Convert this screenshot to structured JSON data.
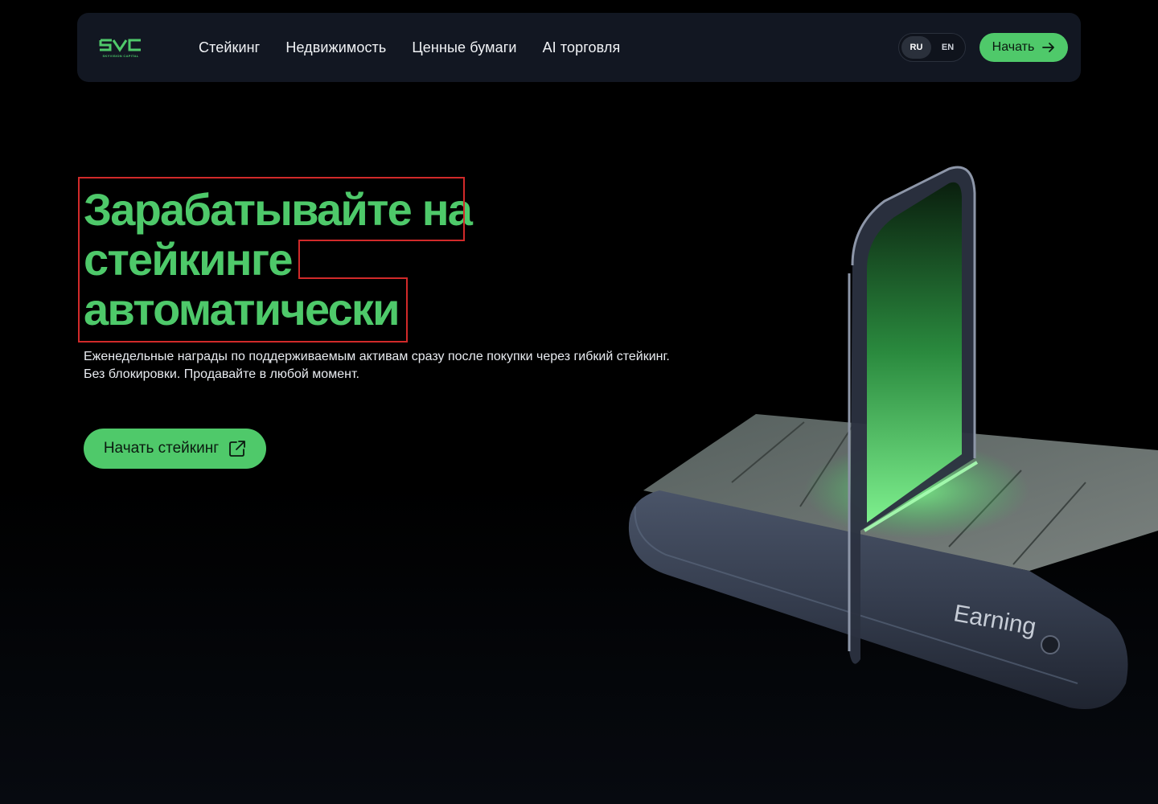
{
  "brand": {
    "logo_text": "SVC",
    "logo_subtitle": "SKYVISION CAPITAL",
    "accent": "#4fc96a"
  },
  "nav": {
    "items": [
      {
        "label": "Стейкинг"
      },
      {
        "label": "Недвижимость"
      },
      {
        "label": "Ценные бумаги"
      },
      {
        "label": "AI торговля"
      }
    ]
  },
  "lang": {
    "options": [
      "RU",
      "EN"
    ],
    "selected": "RU"
  },
  "header": {
    "cta_label": "Начать"
  },
  "hero": {
    "title_lines": [
      "Зарабатывайте на",
      "стейкинге",
      "автоматически"
    ],
    "subtitle_lines": [
      "Еженедельные награды по поддерживаемым активам сразу после покупки через гибкий стейкинг.",
      "Без блокировки. Продавайте в любой момент."
    ],
    "cta_label": "Начать стейкинг",
    "illustration_label": "Earning"
  }
}
